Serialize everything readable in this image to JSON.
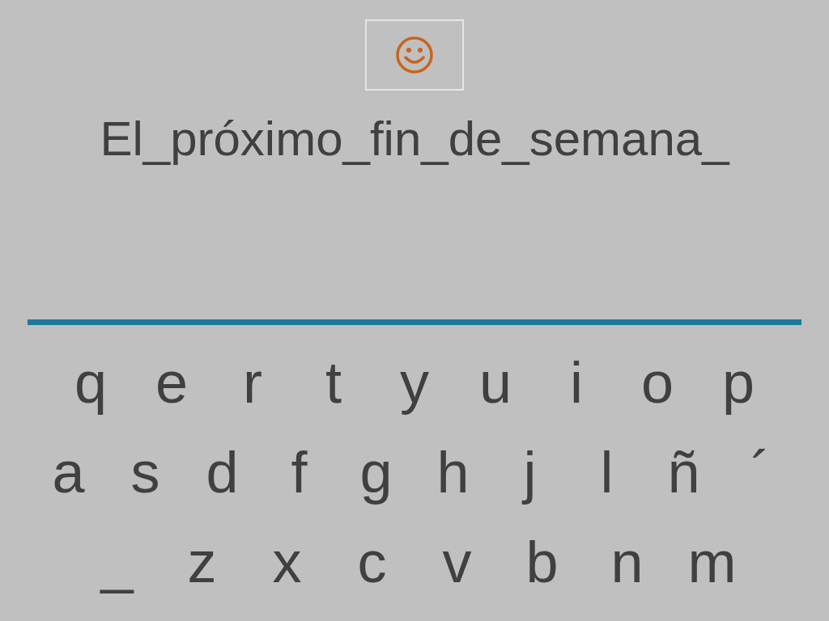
{
  "sentence": "El_próximo_fin_de_semana_",
  "keyboard": {
    "rows": [
      {
        "keys": [
          "q",
          "e",
          "r",
          "t",
          "y",
          "u",
          "i",
          "o",
          "p"
        ]
      },
      {
        "keys": [
          "a",
          "s",
          "d",
          "f",
          "g",
          "h",
          "j",
          "l",
          "ñ",
          "´"
        ]
      },
      {
        "keys": [
          "_",
          "z",
          "x",
          "c",
          "v",
          "b",
          "n",
          "m"
        ]
      }
    ]
  }
}
